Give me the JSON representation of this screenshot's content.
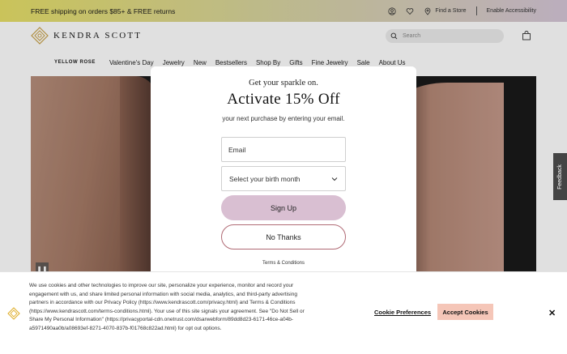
{
  "promo": {
    "text": "FREE shipping on orders $85+ & FREE returns",
    "find_store": "Find a Store",
    "accessibility": "Enable Accessibility"
  },
  "header": {
    "brand": "KENDRA SCOTT",
    "search_placeholder": "Search"
  },
  "nav": {
    "brand": "YELLOW ROSE",
    "items": [
      "Valentine's Day",
      "Jewelry",
      "New",
      "Bestsellers",
      "Shop By",
      "Gifts",
      "Fine Jewelry",
      "Sale",
      "About Us"
    ]
  },
  "modal": {
    "pre": "Get your sparkle on.",
    "title": "Activate 15% Off",
    "subtitle": "your next purchase by entering your email.",
    "email_placeholder": "Email",
    "birth_month": "Select your birth month",
    "signup": "Sign Up",
    "no_thanks": "No Thanks",
    "terms": "Terms & Conditions"
  },
  "feedback": "Feedback",
  "cookie": {
    "text": "We use cookies and other technologies to improve our site, personalize your experience, monitor and record your engagement with us, and share limited personal information with social media, analytics, and third-party advertising partners in accordance with our Privacy Policy (https://www.kendrascott.com/privacy.html) and Terms & Conditions (https://www.kendrascott.com/terms-conditions.html). Your use of this site signals your agreement. See \"Do Not Sell or Share My Personal Information\" (https://privacyportal-cdn.onetrust.com/dsarwebform/89dd8d23-6171-46ce-a04b-a5971490aa0b/a08693ef-8271-4070-837b-f01768c822ad.html) for opt out options.",
    "preferences": "Cookie Preferences",
    "accept": "Accept Cookies",
    "close": "✕"
  },
  "colors": {
    "accent_pink": "#d9bfd2",
    "accept_peach": "#f5c6b8",
    "brand_gold": "#c9a24a"
  }
}
